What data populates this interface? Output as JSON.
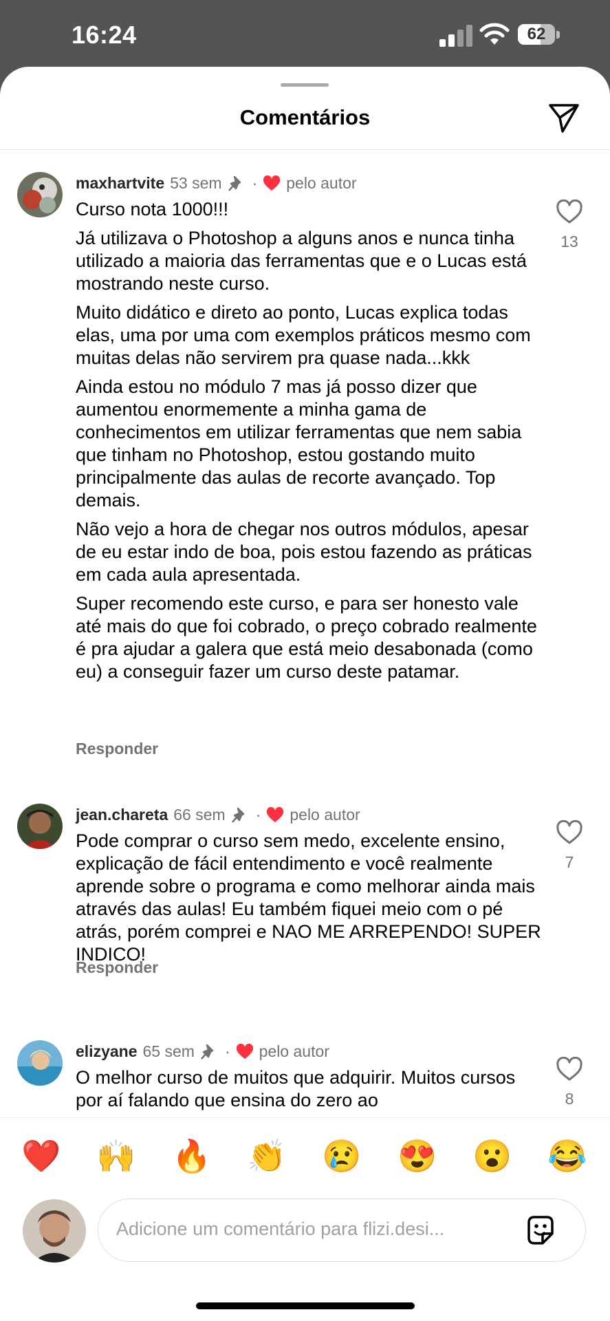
{
  "status_bar": {
    "time": "16:24",
    "battery": "62",
    "battery_level": 0.62
  },
  "sheet": {
    "title": "Comentários",
    "send_icon": "paper-plane-icon"
  },
  "comments": [
    {
      "username": "maxhartvite",
      "age": "53 sem",
      "liked_by": "pelo autor",
      "paragraphs": [
        "Curso nota 1000!!!",
        "Já utilizava o Photoshop a alguns anos e nunca tinha utilizado a maioria das ferramentas que e o Lucas está mostrando neste curso.",
        "Muito didático e direto ao ponto, Lucas explica todas elas, uma por uma com exemplos práticos mesmo com muitas delas não servirem pra quase nada...kkk",
        "Ainda estou no módulo 7 mas já posso dizer que aumentou enormemente a minha gama de conhecimentos em utilizar ferramentas que nem sabia que tinham no Photoshop, estou gostando muito principalmente das aulas de recorte avançado. Top demais.",
        "Não vejo a hora de chegar nos outros módulos, apesar de eu estar indo de boa, pois estou fazendo as práticas em cada aula apresentada.",
        "Super recomendo este curso, e para ser honesto vale até mais do que foi cobrado, o preço cobrado realmente é pra ajudar a galera que está meio desabonada (como eu) a conseguir fazer um curso deste patamar."
      ],
      "reply": "Responder",
      "likes": "13"
    },
    {
      "username": "jean.chareta",
      "age": "66 sem",
      "liked_by": "pelo autor",
      "paragraphs": [
        "Pode comprar o curso sem medo, excelente ensino, explicação de fácil entendimento e você realmente aprende sobre o programa e como melhorar ainda mais através das aulas! Eu também fiquei meio com o pé atrás, porém comprei e NAO ME ARREPENDO! SUPER INDICO!"
      ],
      "reply": "Responder",
      "likes": "7"
    },
    {
      "username": "elizyane",
      "age": "65 sem",
      "liked_by": "pelo autor",
      "paragraphs": [
        "O melhor curso de muitos que adquirir. Muitos cursos por aí falando que ensina do zero ao"
      ],
      "likes": "8"
    }
  ],
  "reactions": [
    "❤️",
    "🙌",
    "🔥",
    "👏",
    "😢",
    "😍",
    "😮",
    "😂"
  ],
  "composer": {
    "placeholder": "Adicione um comentário para flizi.desi...",
    "sticker_icon": "sticker-icon"
  },
  "colors": {
    "heart": "#ff3040",
    "secondary_text": "#737373"
  }
}
